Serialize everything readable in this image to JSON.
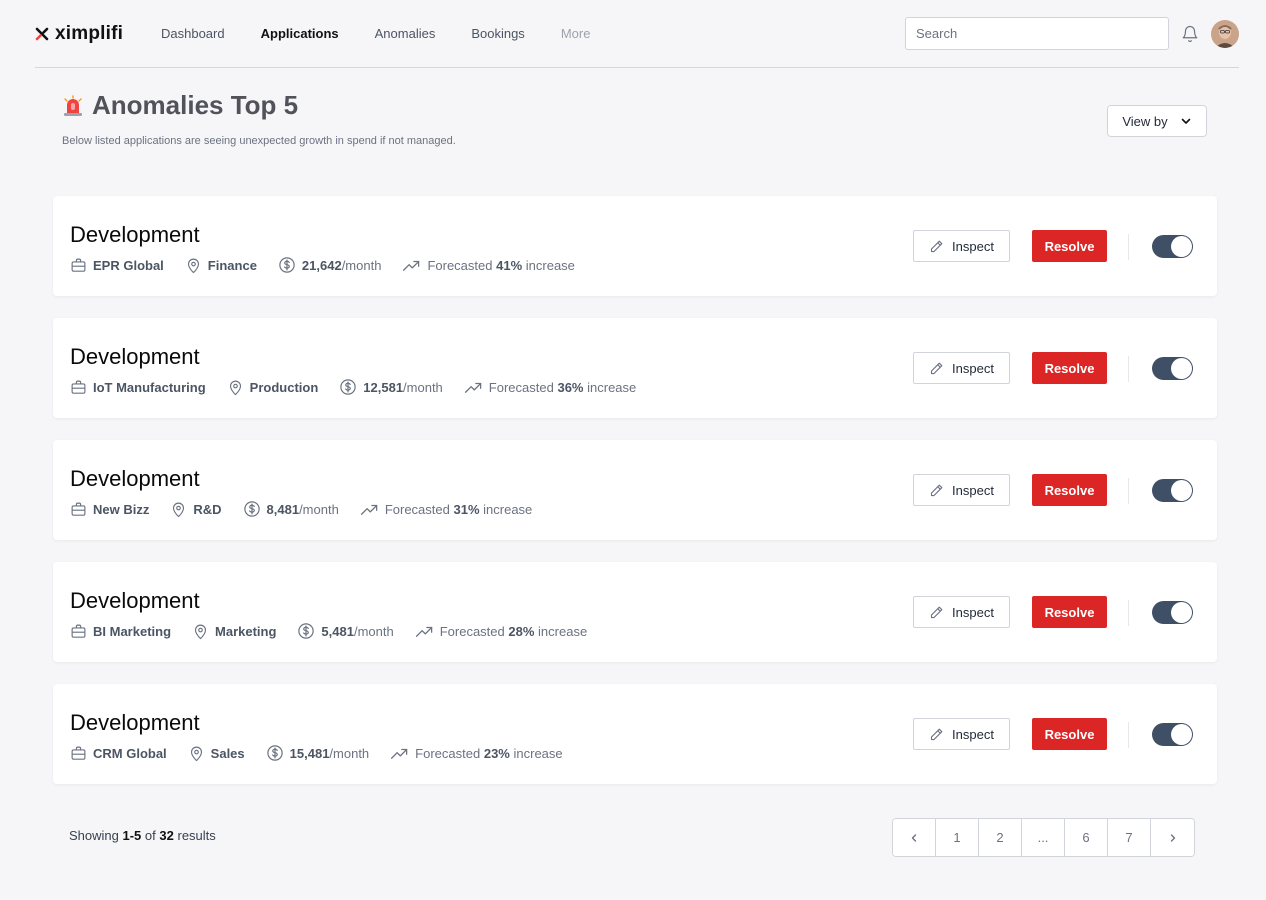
{
  "brand": {
    "name": "ximplifi"
  },
  "nav": {
    "links": [
      {
        "label": "Dashboard"
      },
      {
        "label": "Applications"
      },
      {
        "label": "Anomalies"
      },
      {
        "label": "Bookings"
      },
      {
        "label": "More"
      }
    ],
    "active": "Applications",
    "search_placeholder": "Search"
  },
  "header": {
    "title": "Anomalies Top 5",
    "subtitle": "Below listed applications are seeing unexpected growth in spend if not managed.",
    "view_by_label": "View by"
  },
  "cards": [
    {
      "title": "Development",
      "company": "EPR Global",
      "department": "Finance",
      "amount": "21,642",
      "amount_suffix": "/month",
      "forecast_prefix": "Forecasted",
      "forecast_pct": "41%",
      "forecast_suffix": "increase",
      "inspect_label": "Inspect",
      "resolve_label": "Resolve",
      "toggle_on": true
    },
    {
      "title": "Development",
      "company": "IoT Manufacturing",
      "department": "Production",
      "amount": "12,581",
      "amount_suffix": "/month",
      "forecast_prefix": "Forecasted",
      "forecast_pct": "36%",
      "forecast_suffix": "increase",
      "inspect_label": "Inspect",
      "resolve_label": "Resolve",
      "toggle_on": true
    },
    {
      "title": "Development",
      "company": "New Bizz",
      "department": "R&D",
      "amount": "8,481",
      "amount_suffix": "/month",
      "forecast_prefix": "Forecasted",
      "forecast_pct": "31%",
      "forecast_suffix": "increase",
      "inspect_label": "Inspect",
      "resolve_label": "Resolve",
      "toggle_on": true
    },
    {
      "title": "Development",
      "company": "BI Marketing",
      "department": "Marketing",
      "amount": "5,481",
      "amount_suffix": "/month",
      "forecast_prefix": "Forecasted",
      "forecast_pct": "28%",
      "forecast_suffix": "increase",
      "inspect_label": "Inspect",
      "resolve_label": "Resolve",
      "toggle_on": true
    },
    {
      "title": "Development",
      "company": "CRM Global",
      "department": "Sales",
      "amount": "15,481",
      "amount_suffix": "/month",
      "forecast_prefix": "Forecasted",
      "forecast_pct": "23%",
      "forecast_suffix": "increase",
      "inspect_label": "Inspect",
      "resolve_label": "Resolve",
      "toggle_on": true
    }
  ],
  "footer": {
    "showing_prefix": "Showing",
    "range": "1-5",
    "of_word": "of",
    "total": "32",
    "results_word": "results",
    "pages": [
      "1",
      "2",
      "...",
      "6",
      "7"
    ]
  },
  "colors": {
    "resolve": "#dc2626",
    "toggle": "#3f4f66",
    "background": "#f6f6f8"
  }
}
